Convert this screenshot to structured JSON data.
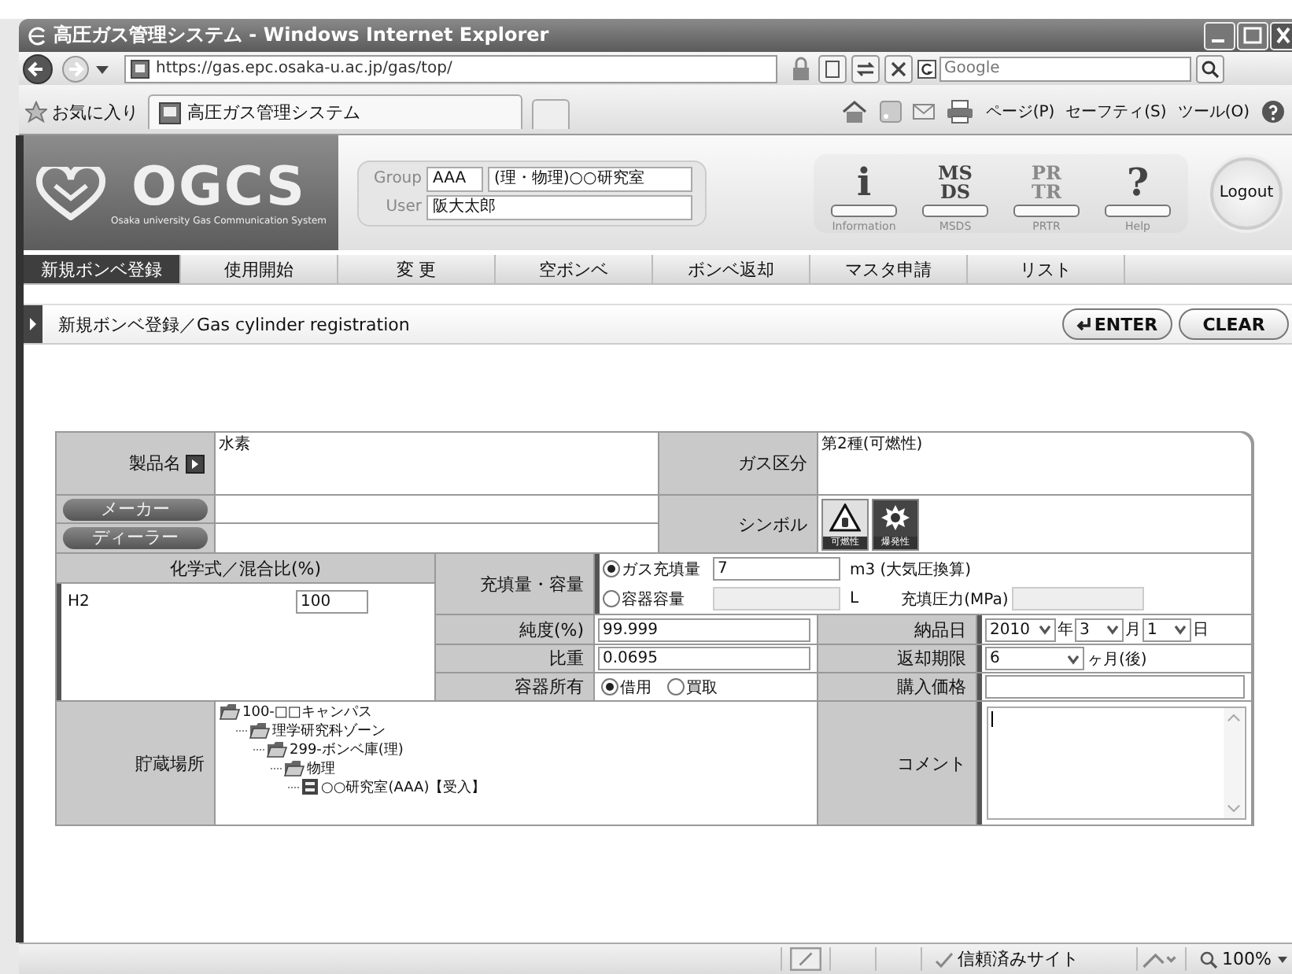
{
  "window": {
    "title": "高圧ガス管理システム - Windows Internet Explorer"
  },
  "address_bar": {
    "url": "https://gas.epc.osaka-u.ac.jp/gas/top/",
    "search_placeholder": "Google"
  },
  "favorites_bar": {
    "favorites": "お気に入り",
    "tab": "高圧ガス管理システム",
    "commands": [
      "ページ(P)",
      "セーフティ(S)",
      "ツール(O)"
    ]
  },
  "header": {
    "logo": "OGCS",
    "logo_subtitle": "Osaka university Gas Communication System",
    "group_label": "Group",
    "group_code": "AAA",
    "group_name": "(理・物理)○○研究室",
    "user_label": "User",
    "user_name": "阪大太郎",
    "tools": [
      {
        "glyph": [
          "i"
        ],
        "label": "Information",
        "disabled": false
      },
      {
        "glyph": [
          "MS",
          "DS"
        ],
        "label": "MSDS",
        "disabled": false
      },
      {
        "glyph": [
          "PR",
          "TR"
        ],
        "label": "PRTR",
        "disabled": true
      },
      {
        "glyph": [
          "?"
        ],
        "label": "Help",
        "disabled": false
      }
    ],
    "logout": "Logout"
  },
  "nav": [
    {
      "label": "新規ボンベ登録",
      "selected": true
    },
    {
      "label": "使用開始",
      "selected": false
    },
    {
      "label": "変 更",
      "selected": false
    },
    {
      "label": "空ボンベ",
      "selected": false
    },
    {
      "label": "ボンベ返却",
      "selected": false
    },
    {
      "label": "マスタ申請",
      "selected": false
    },
    {
      "label": "リスト",
      "selected": false
    }
  ],
  "page_title": "新規ボンベ登録／Gas cylinder registration",
  "actions": [
    {
      "kind": "submit",
      "label": "ENTER"
    },
    {
      "kind": "reset",
      "label": "CLEAR"
    }
  ],
  "form": {
    "product": {
      "label": "製品名",
      "value": "水素"
    },
    "gas_class": {
      "label": "ガス区分",
      "value": "第2種(可燃性)"
    },
    "maker": {
      "label": "メーカー"
    },
    "dealer": {
      "label": "ディーラー"
    },
    "symbol": {
      "label": "シンボル",
      "items": [
        {
          "kind": "flammable",
          "label": "可燃性"
        },
        {
          "kind": "explosive",
          "label": "爆発性"
        }
      ]
    },
    "formula": {
      "label": "化学式／混合比(%)",
      "rows": [
        {
          "formula": "H2",
          "ratio": "100"
        }
      ]
    },
    "fill": {
      "label": "充填量・容量",
      "options": [
        {
          "label": "ガス充填量",
          "selected": true,
          "value": "7",
          "unit": "m3 (大気圧換算)"
        },
        {
          "label": "容器容量",
          "selected": false,
          "unit": "L"
        }
      ],
      "pressure_label": "充填圧力(MPa)"
    },
    "purity": {
      "label": "純度(%)",
      "value": "99.999"
    },
    "specific_gravity": {
      "label": "比重",
      "value": "0.0695"
    },
    "ownership": {
      "label": "容器所有",
      "options": [
        {
          "label": "借用",
          "selected": true
        },
        {
          "label": "買取",
          "selected": false
        }
      ]
    },
    "delivery_date": {
      "label": "納品日",
      "year": "2010",
      "year_unit": "年",
      "month": "3",
      "month_unit": "月",
      "day": "1",
      "day_unit": "日"
    },
    "return_period": {
      "label": "返却期限",
      "value": "6",
      "unit": "ヶ月(後)"
    },
    "price": {
      "label": "購入価格"
    },
    "storage": {
      "label": "貯蔵場所",
      "tree": [
        {
          "kind": "folder",
          "label": "100-□□キャンパス",
          "children": [
            {
              "kind": "folder",
              "label": "理学研究科ゾーン",
              "children": [
                {
                  "kind": "folder",
                  "label": "299-ボンベ庫(理)",
                  "children": [
                    {
                      "kind": "folder",
                      "label": "物理",
                      "children": [
                        {
                          "kind": "room",
                          "label": "○○研究室(AAA)【受入】"
                        }
                      ]
                    }
                  ]
                }
              ]
            }
          ]
        }
      ]
    },
    "comment": {
      "label": "コメント"
    }
  },
  "status_bar": {
    "zone": "信頼済みサイト",
    "zoom": "100%"
  }
}
